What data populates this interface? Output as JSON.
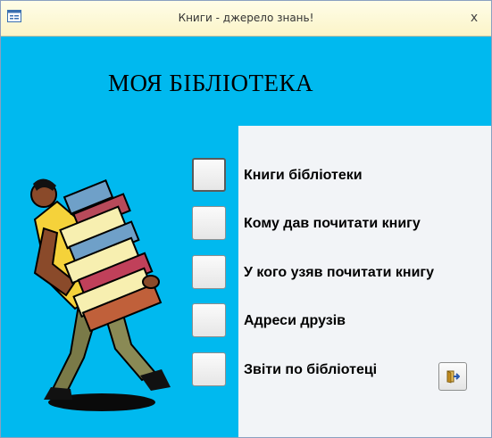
{
  "window": {
    "title": "Книги - джерело знань!",
    "icon": "form-icon",
    "close_label": "x"
  },
  "main": {
    "heading": "МОЯ БІБЛІОТЕКА",
    "illustration": "man-carrying-books-clipart"
  },
  "menu": {
    "items": [
      {
        "label": "Книги бібліотеки",
        "icon": "blank-button"
      },
      {
        "label": "Кому дав почитати книгу",
        "icon": "blank-button"
      },
      {
        "label": "У кого узяв почитати книгу",
        "icon": "blank-button"
      },
      {
        "label": "Адреси друзів",
        "icon": "blank-button"
      },
      {
        "label": "Звіти по бібліотеці",
        "icon": "blank-button"
      }
    ]
  },
  "exit_button": {
    "icon": "exit-door-icon"
  },
  "colors": {
    "background": "#00b9ef",
    "panel": "#f2f4f7",
    "titlebar": "#fbf4c8"
  }
}
